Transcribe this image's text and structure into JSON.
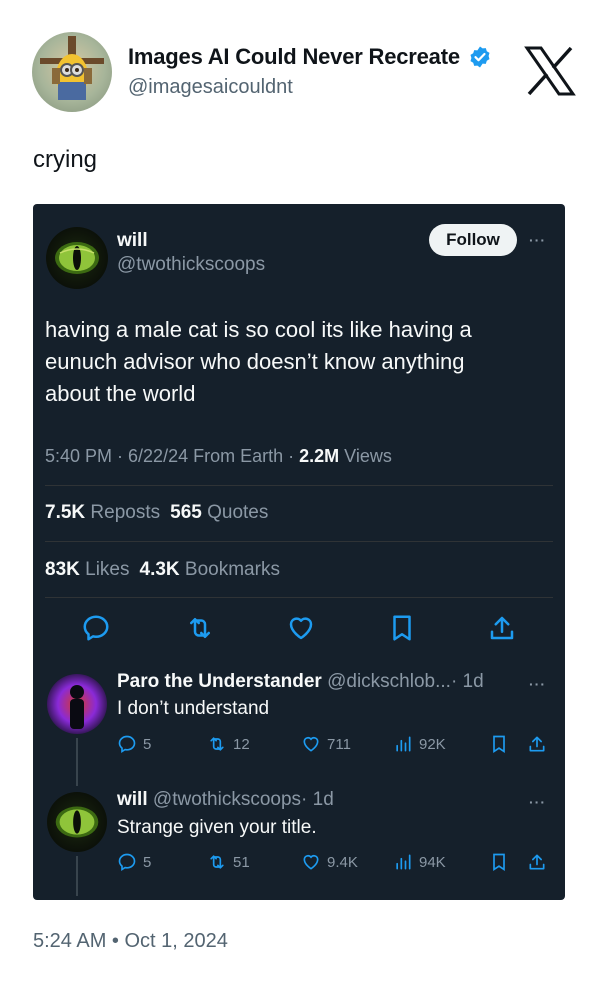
{
  "author": {
    "name": "Images AI Could Never Recreate",
    "handle": "@imagesaicouldnt"
  },
  "post": {
    "caption": "crying",
    "timestamp": "5:24 AM • Oct 1, 2024"
  },
  "embedded": {
    "name": "will",
    "handle": "@twothickscoops",
    "follow_label": "Follow",
    "text": "having a male cat is so cool its like having a eunuch advisor who doesn’t know anything about the world",
    "meta_prefix": "5:40 PM · 6/22/24 From Earth · ",
    "views_count": "2.2M",
    "views_label": " Views",
    "reposts_count": "7.5K",
    "reposts_label": " Reposts",
    "quotes_count": "565",
    "quotes_label": " Quotes",
    "likes_count": "83K",
    "likes_label": " Likes",
    "bookmarks_count": "4.3K",
    "bookmarks_label": " Bookmarks",
    "more": "···"
  },
  "replies": [
    {
      "name": "Paro the Understander",
      "handle": "@dickschlob...",
      "time": "· 1d",
      "text": "I don’t understand",
      "replies": "5",
      "reposts": "12",
      "likes": "711",
      "views": "92K"
    },
    {
      "name": "will",
      "handle": "@twothickscoops",
      "time": "· 1d",
      "text": "Strange given your title.",
      "replies": "5",
      "reposts": "51",
      "likes": "9.4K",
      "views": "94K"
    }
  ],
  "colors": {
    "verified": "#1d9bf0",
    "card_bg": "#15202b",
    "muted": "#8b98a5",
    "accent_icon": "#1d9bf0"
  },
  "icons": [
    "verified-badge-icon",
    "x-logo-icon",
    "reply-icon",
    "repost-icon",
    "like-icon",
    "bookmark-icon",
    "share-icon",
    "views-icon",
    "more-icon"
  ]
}
